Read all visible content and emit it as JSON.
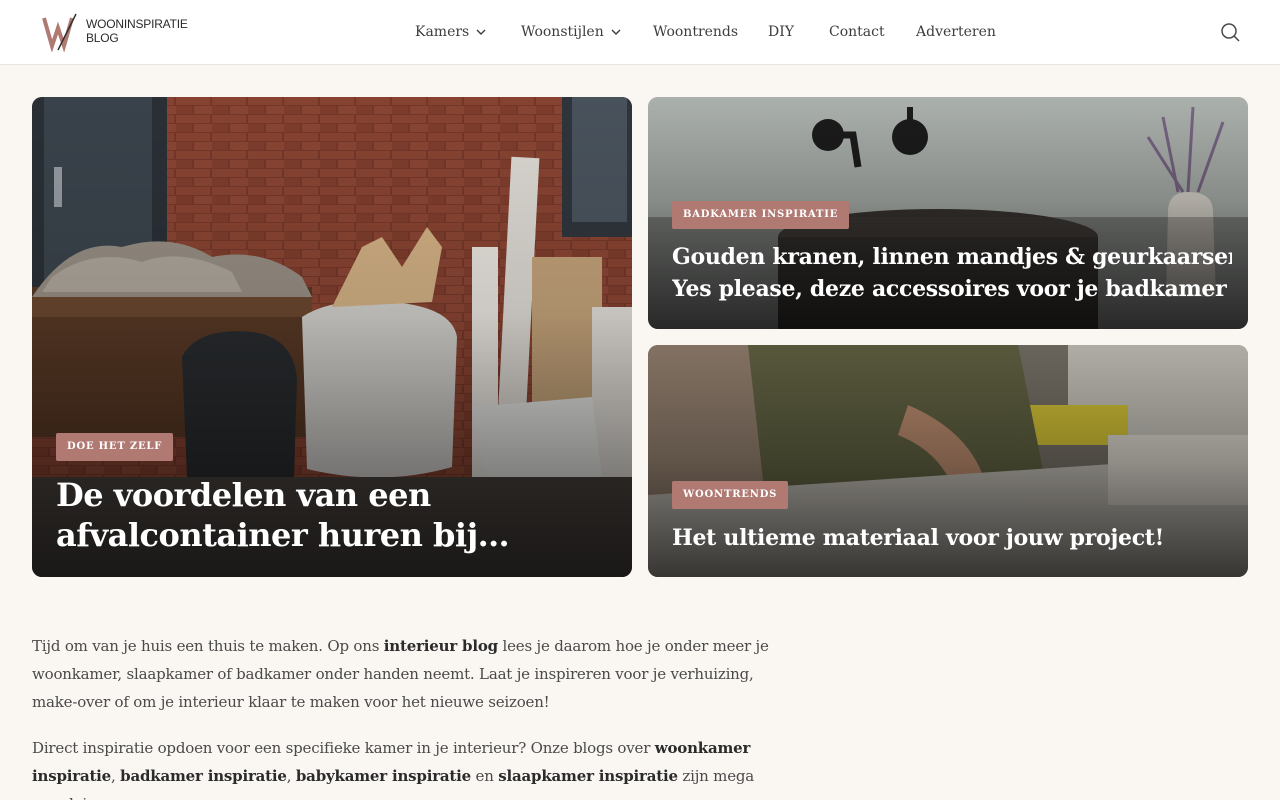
{
  "brand": {
    "logo_letter": "W",
    "logo_line1": "WOONINSPIRATIE",
    "logo_line2": "BLOG",
    "accent": "#b07a73"
  },
  "nav": {
    "items": [
      {
        "label": "Kamers",
        "has_dropdown": true
      },
      {
        "label": "Woonstijlen",
        "has_dropdown": true
      },
      {
        "label": "Woontrends",
        "has_dropdown": false
      },
      {
        "label": "DIY",
        "has_dropdown": false
      },
      {
        "label": "Contact",
        "has_dropdown": false
      },
      {
        "label": "Adverteren",
        "has_dropdown": false
      }
    ],
    "search_icon": "search-icon"
  },
  "featured": [
    {
      "category": "DOE HET ZELF",
      "title": "De voordelen van een afvalcontainer huren bij…"
    },
    {
      "category": "BADKAMER INSPIRATIE",
      "title_line1": "Gouden kranen, linnen mandjes & geurkaarsen?",
      "title_line2": "Yes please, deze accessoires voor je badkamer …"
    },
    {
      "category": "WOONTRENDS",
      "title": "Het ultieme materiaal voor jouw project!"
    }
  ],
  "intro": {
    "p1": {
      "t1": "Tijd om van je huis een thuis te maken. Op ons ",
      "link1": "interieur blog",
      "t2": " lees je daarom hoe je onder meer je woonkamer, slaapkamer of badkamer onder handen neemt. Laat je inspireren voor je verhuizing, make-over of om je interieur klaar te maken voor het nieuwe seizoen!"
    },
    "p2": {
      "t1": "Direct inspiratie opdoen voor een specifieke kamer in je interieur? Onze blogs over ",
      "link1": "woonkamer inspiratie",
      "sep1": ", ",
      "link2": "badkamer inspiratie",
      "sep2": ", ",
      "link3": "babykamer inspiratie",
      "t2": " en ",
      "link4": "slaapkamer inspiratie",
      "t3": " zijn mega populair."
    }
  }
}
